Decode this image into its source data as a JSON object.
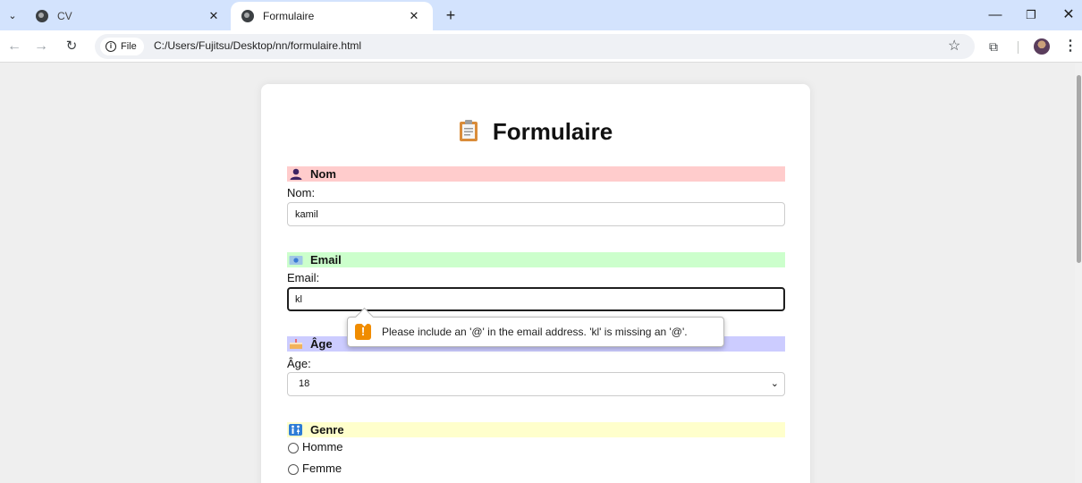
{
  "browser": {
    "tabs": [
      {
        "title": "CV",
        "active": false
      },
      {
        "title": "Formulaire",
        "active": true
      }
    ],
    "tab_search_icon": "chevron-down-icon",
    "new_tab_icon": "plus-icon",
    "address": {
      "chip_label": "File",
      "url": "C:/Users/Fujitsu/Desktop/nn/formulaire.html"
    }
  },
  "form": {
    "title": "Formulaire",
    "sections": {
      "nom": {
        "heading": "Nom",
        "label": "Nom:",
        "value": "kamil",
        "color": "#ffcccc"
      },
      "email": {
        "heading": "Email",
        "label": "Email:",
        "value": "kl",
        "color": "#ccffcc"
      },
      "age": {
        "heading": "Âge",
        "label": "Âge:",
        "selected": "18",
        "color": "#ccccff"
      },
      "genre": {
        "heading": "Genre",
        "options": [
          "Homme",
          "Femme"
        ],
        "color": "#ffffcc"
      }
    },
    "validation_message": "Please include an '@' in the email address. 'kl' is missing an '@'."
  }
}
